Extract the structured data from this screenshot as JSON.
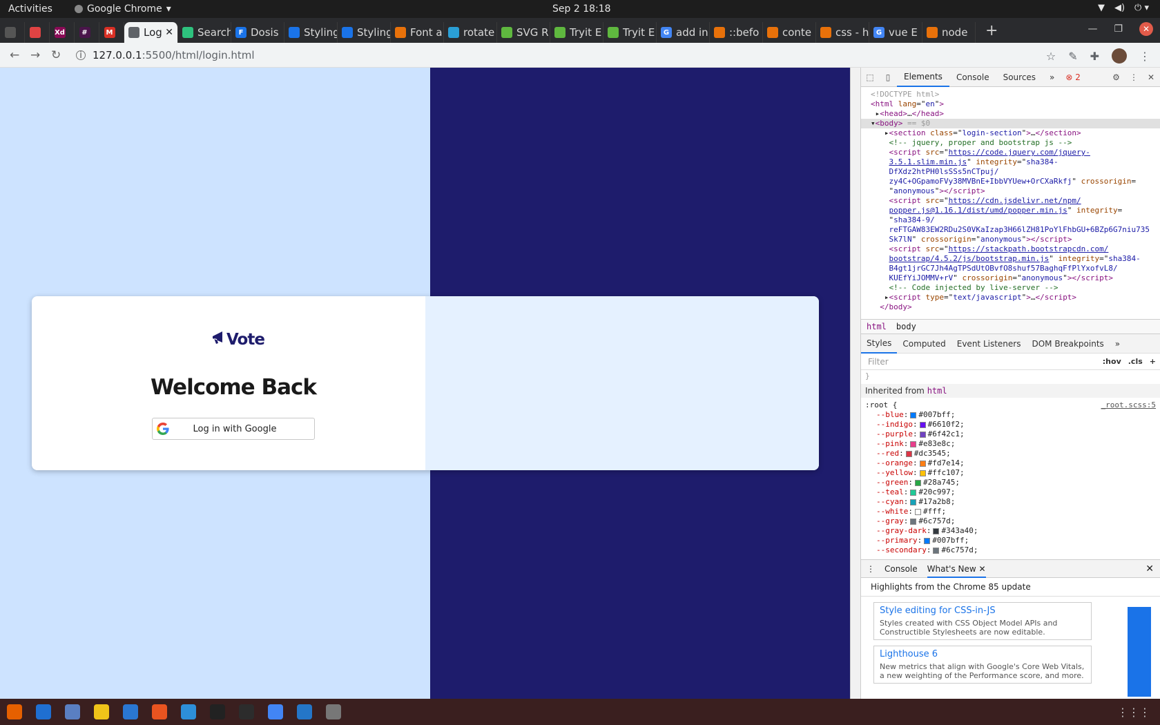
{
  "system": {
    "activities": "Activities",
    "app_name": "Google Chrome",
    "clock": "Sep 2  18:18"
  },
  "tabs": [
    {
      "label": "",
      "color": "#555555",
      "small": true
    },
    {
      "label": "",
      "color": "#e04343",
      "small": true
    },
    {
      "label": "",
      "color": "#8a0b56",
      "small": true,
      "glyph": "Xd"
    },
    {
      "label": "",
      "color": "#4a154b",
      "small": true,
      "glyph": "#"
    },
    {
      "label": "",
      "color": "#d93025",
      "small": true,
      "glyph": "M"
    },
    {
      "label": "Log",
      "color": "#5f6368",
      "active": true
    },
    {
      "label": "Search",
      "color": "#2ec27e"
    },
    {
      "label": "Dosis",
      "color": "#1a73e8",
      "glyph": "F"
    },
    {
      "label": "Styling",
      "color": "#1a73e8"
    },
    {
      "label": "Styling",
      "color": "#1a73e8"
    },
    {
      "label": "Font a",
      "color": "#e8710a"
    },
    {
      "label": "rotate",
      "color": "#2a9fd6"
    },
    {
      "label": "SVG R",
      "color": "#5fb83f"
    },
    {
      "label": "Tryit E",
      "color": "#5fb83f"
    },
    {
      "label": "Tryit E",
      "color": "#5fb83f"
    },
    {
      "label": "add in",
      "color": "#4285f4",
      "glyph": "G"
    },
    {
      "label": "::befo",
      "color": "#e8710a"
    },
    {
      "label": "conte",
      "color": "#e8710a"
    },
    {
      "label": "css - h",
      "color": "#e8710a"
    },
    {
      "label": "vue E",
      "color": "#4285f4",
      "glyph": "G"
    },
    {
      "label": "node",
      "color": "#e8710a"
    }
  ],
  "address": {
    "host": "127.0.0.1",
    "path": ":5500/html/login.html"
  },
  "page": {
    "logo_text": "Vote",
    "heading": "Welcome Back",
    "google_button": "Log in with Google",
    "colors": {
      "left_bg": "#cde3ff",
      "right_bg": "#1e1c6c",
      "card_right": "#e5f1ff"
    }
  },
  "devtools": {
    "tabs": [
      "Elements",
      "Console",
      "Sources"
    ],
    "error_count": "2",
    "dom_lines": [
      {
        "html": "<span class='gray'>&lt;!DOCTYPE html&gt;</span>"
      },
      {
        "html": "<span class='tag'>&lt;html</span> <span class='attr'>lang</span>=\"<span class='val'>en</span>\"<span class='tag'>&gt;</span>"
      },
      {
        "html": " ▸<span class='tag'>&lt;head&gt;</span>…<span class='tag'>&lt;/head&gt;</span>"
      },
      {
        "html": "▾<span class='tag'>&lt;body&gt;</span> <span class='gray'>== $0</span>",
        "sel": true
      },
      {
        "html": "   ▸<span class='tag'>&lt;section</span> <span class='attr'>class</span>=\"<span class='val'>login-section</span>\"<span class='tag'>&gt;</span>…<span class='tag'>&lt;/section&gt;</span>"
      },
      {
        "html": "    <span class='cmt'>&lt;!-- jquery, proper and bootstrap js --&gt;</span>"
      },
      {
        "html": "    <span class='tag'>&lt;script</span> <span class='attr'>src</span>=\"<span class='lnk'>https://code.jquery.com/jquery-</span>"
      },
      {
        "html": "    <span class='lnk'>3.5.1.slim.min.js</span>\" <span class='attr'>integrity</span>=\"<span class='val'>sha384-</span>"
      },
      {
        "html": "    <span class='val'>DfXdz2htPH0lsSSs5nCTpuj/</span>"
      },
      {
        "html": "    <span class='val'>zy4C+OGpamoFVy38MVBnE+IbbVYUew+OrCXaRkfj</span>\" <span class='attr'>crossorigin</span>="
      },
      {
        "html": "    \"<span class='val'>anonymous</span>\"<span class='tag'>&gt;&lt;/script&gt;</span>"
      },
      {
        "html": "    <span class='tag'>&lt;script</span> <span class='attr'>src</span>=\"<span class='lnk'>https://cdn.jsdelivr.net/npm/</span>"
      },
      {
        "html": "    <span class='lnk'>popper.js@1.16.1/dist/umd/popper.min.js</span>\" <span class='attr'>integrity</span>="
      },
      {
        "html": "    \"<span class='val'>sha384-9/</span>"
      },
      {
        "html": "    <span class='val'>reFTGAW83EW2RDu2S0VKaIzap3H66lZH81PoYlFhbGU+6BZp6G7niu735</span>"
      },
      {
        "html": "    <span class='val'>Sk7lN</span>\" <span class='attr'>crossorigin</span>=\"<span class='val'>anonymous</span>\"<span class='tag'>&gt;&lt;/script&gt;</span>"
      },
      {
        "html": "    <span class='tag'>&lt;script</span> <span class='attr'>src</span>=\"<span class='lnk'>https://stackpath.bootstrapcdn.com/</span>"
      },
      {
        "html": "    <span class='lnk'>bootstrap/4.5.2/js/bootstrap.min.js</span>\" <span class='attr'>integrity</span>=\"<span class='val'>sha384-</span>"
      },
      {
        "html": "    <span class='val'>B4gt1jrGC7Jh4AgTPSdUtOBvfO8shuf57BaghqFfPlYxofvL8/</span>"
      },
      {
        "html": "    <span class='val'>KUEfYiJOMMV+rV</span>\" <span class='attr'>crossorigin</span>=\"<span class='val'>anonymous</span>\"<span class='tag'>&gt;&lt;/script&gt;</span>"
      },
      {
        "html": "    <span class='cmt'>&lt;!-- Code injected by live-server --&gt;</span>"
      },
      {
        "html": "   ▸<span class='tag'>&lt;script</span> <span class='attr'>type</span>=\"<span class='val'>text/javascript</span>\"<span class='tag'>&gt;</span>…<span class='tag'>&lt;/script&gt;</span>"
      },
      {
        "html": "  <span class='tag'>&lt;/body&gt;</span>"
      }
    ],
    "crumbs": [
      "html",
      "body"
    ],
    "subtabs": [
      "Styles",
      "Computed",
      "Event Listeners",
      "DOM Breakpoints"
    ],
    "filter_placeholder": "Filter",
    "hov": ":hov",
    "cls": ".cls",
    "inherited_label": "Inherited from",
    "inherited_tag": "html",
    "root_selector": ":root {",
    "root_source": "_root.scss:5",
    "css_vars": [
      {
        "name": "--blue",
        "value": "#007bff"
      },
      {
        "name": "--indigo",
        "value": "#6610f2"
      },
      {
        "name": "--purple",
        "value": "#6f42c1"
      },
      {
        "name": "--pink",
        "value": "#e83e8c"
      },
      {
        "name": "--red",
        "value": "#dc3545"
      },
      {
        "name": "--orange",
        "value": "#fd7e14"
      },
      {
        "name": "--yellow",
        "value": "#ffc107"
      },
      {
        "name": "--green",
        "value": "#28a745"
      },
      {
        "name": "--teal",
        "value": "#20c997"
      },
      {
        "name": "--cyan",
        "value": "#17a2b8"
      },
      {
        "name": "--white",
        "value": "#fff"
      },
      {
        "name": "--gray",
        "value": "#6c757d"
      },
      {
        "name": "--gray-dark",
        "value": "#343a40"
      },
      {
        "name": "--primary",
        "value": "#007bff"
      },
      {
        "name": "--secondary",
        "value": "#6c757d"
      }
    ],
    "drawer_tabs": [
      "Console",
      "What's New"
    ],
    "whats_new_heading": "Highlights from the Chrome 85 update",
    "cards": [
      {
        "title": "Style editing for CSS-in-JS",
        "desc": "Styles created with CSS Object Model APIs and Constructible Stylesheets are now editable."
      },
      {
        "title": "Lighthouse 6",
        "desc": "New metrics that align with Google's Core Web Vitals, a new weighting of the Performance score, and more."
      }
    ]
  },
  "dock": [
    {
      "name": "firefox-icon",
      "color": "#e66000"
    },
    {
      "name": "thunderbird-icon",
      "color": "#1f6fd1"
    },
    {
      "name": "files-icon",
      "color": "#5a7fc2"
    },
    {
      "name": "rhythmbox-icon",
      "color": "#f0c419"
    },
    {
      "name": "writer-icon",
      "color": "#2a77d2"
    },
    {
      "name": "software-icon",
      "color": "#e95420"
    },
    {
      "name": "help-icon",
      "color": "#2d8fd9"
    },
    {
      "name": "amazon-icon",
      "color": "#222222"
    },
    {
      "name": "terminal-icon",
      "color": "#2c2c2c"
    },
    {
      "name": "chrome-icon",
      "color": "#4285f4"
    },
    {
      "name": "vscode-icon",
      "color": "#2476c8"
    },
    {
      "name": "usb-drive-icon",
      "color": "#777777"
    }
  ]
}
